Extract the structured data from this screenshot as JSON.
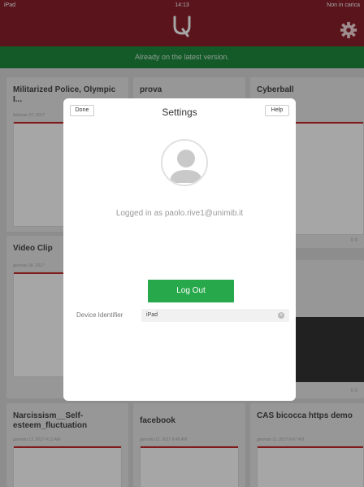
{
  "status": {
    "device": "iPad",
    "time": "14:13",
    "battery_text": "Non in carica"
  },
  "banner": {
    "text": "Already on the latest version."
  },
  "cards": [
    {
      "title": "Militarized Police, Olympic I...",
      "date": "febbraio 07, 2017",
      "counts": ""
    },
    {
      "title": "prova",
      "date": "",
      "counts": ""
    },
    {
      "title": "Cyberball",
      "date": "",
      "counts": "0 0"
    },
    {
      "title": "Video Clip",
      "date": "gennaio 30, 2017",
      "counts": "0 0"
    },
    {
      "title": "",
      "date": "",
      "counts": "0 0"
    },
    {
      "title": "",
      "date": "",
      "counts": "0 0"
    },
    {
      "title": "Narcissism__Self-esteem_fluctuation",
      "date": "gennaio 13, 2017 4:11 AM",
      "counts": ""
    },
    {
      "title": "facebook",
      "date": "gennaio 11, 2017 8:48 AM",
      "counts": ""
    },
    {
      "title": "CAS bicocca https demo",
      "date": "gennaio 11, 2017 8:47 AM",
      "counts": ""
    }
  ],
  "modal": {
    "title": "Settings",
    "done_label": "Done",
    "help_label": "Help",
    "logged_in_text": "Logged in as paolo.rive1@unimib.it",
    "logout_label": "Log Out",
    "device_identifier_label": "Device Identifier",
    "device_identifier_value": "iPad"
  },
  "colors": {
    "topbar": "#8b1f2a",
    "banner": "#1f8a3f",
    "logout": "#27a84a"
  },
  "icons": [
    "wifi-icon",
    "logo-icon",
    "gear-icon",
    "avatar-icon",
    "clear-icon"
  ]
}
